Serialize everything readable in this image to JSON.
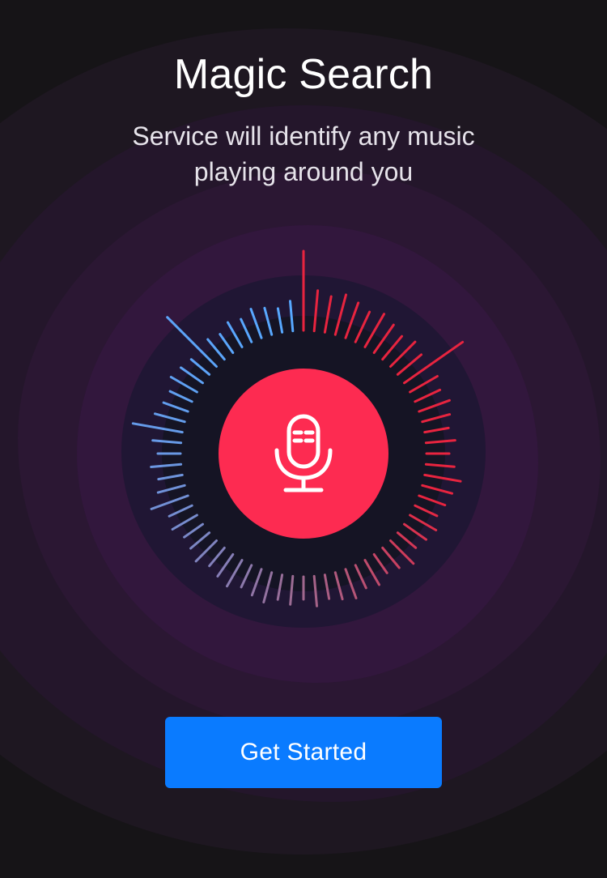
{
  "header": {
    "title": "Magic Search",
    "subtitle": "Service will identify any music playing around you"
  },
  "visualizer": {
    "icon": "microphone-icon",
    "colors": {
      "button": "#fd2b51",
      "bars_left": "#57a8ff",
      "bars_right": "#e8243f",
      "bars_bottom": "#a0688e"
    }
  },
  "actions": {
    "get_started_label": "Get Started"
  },
  "colors": {
    "background": "#161417",
    "accent": "#0a7bff"
  }
}
